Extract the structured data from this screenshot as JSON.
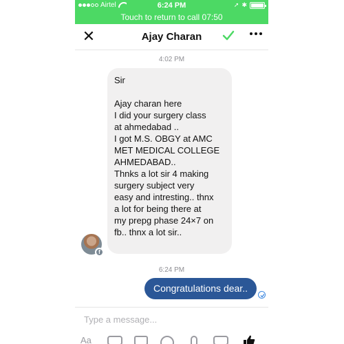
{
  "status_bar": {
    "carrier": "Airtel",
    "time": "6:24 PM",
    "battery": "100%",
    "call_banner": "Touch to return to call 07:50"
  },
  "nav": {
    "title": "Ajay Charan"
  },
  "conversation": {
    "timestamp_1": "4:02 PM",
    "incoming_lines": [
      "Sir",
      "",
      "Ajay charan here",
      "I did your surgery class",
      "at ahmedabad ..",
      "I got M.S. OBGY at AMC",
      "MET MEDICAL COLLEGE",
      "AHMEDABAD..",
      "Thnks a lot sir 4 making",
      "surgery subject very",
      "easy and intresting.. thnx",
      "a lot for being there at",
      "my prepg phase 24×7 on",
      "fb.. thnx a lot sir.."
    ],
    "timestamp_2": "6:24 PM",
    "outgoing": "Congratulations dear.."
  },
  "composer": {
    "placeholder": "Type a message..."
  },
  "toolbar": {
    "aa_label": "Aa"
  },
  "colors": {
    "call_banner": "#4cd964",
    "outgoing_bubble": "#2b5797",
    "incoming_bubble": "#f1f0f0",
    "check": "#4cd964"
  }
}
